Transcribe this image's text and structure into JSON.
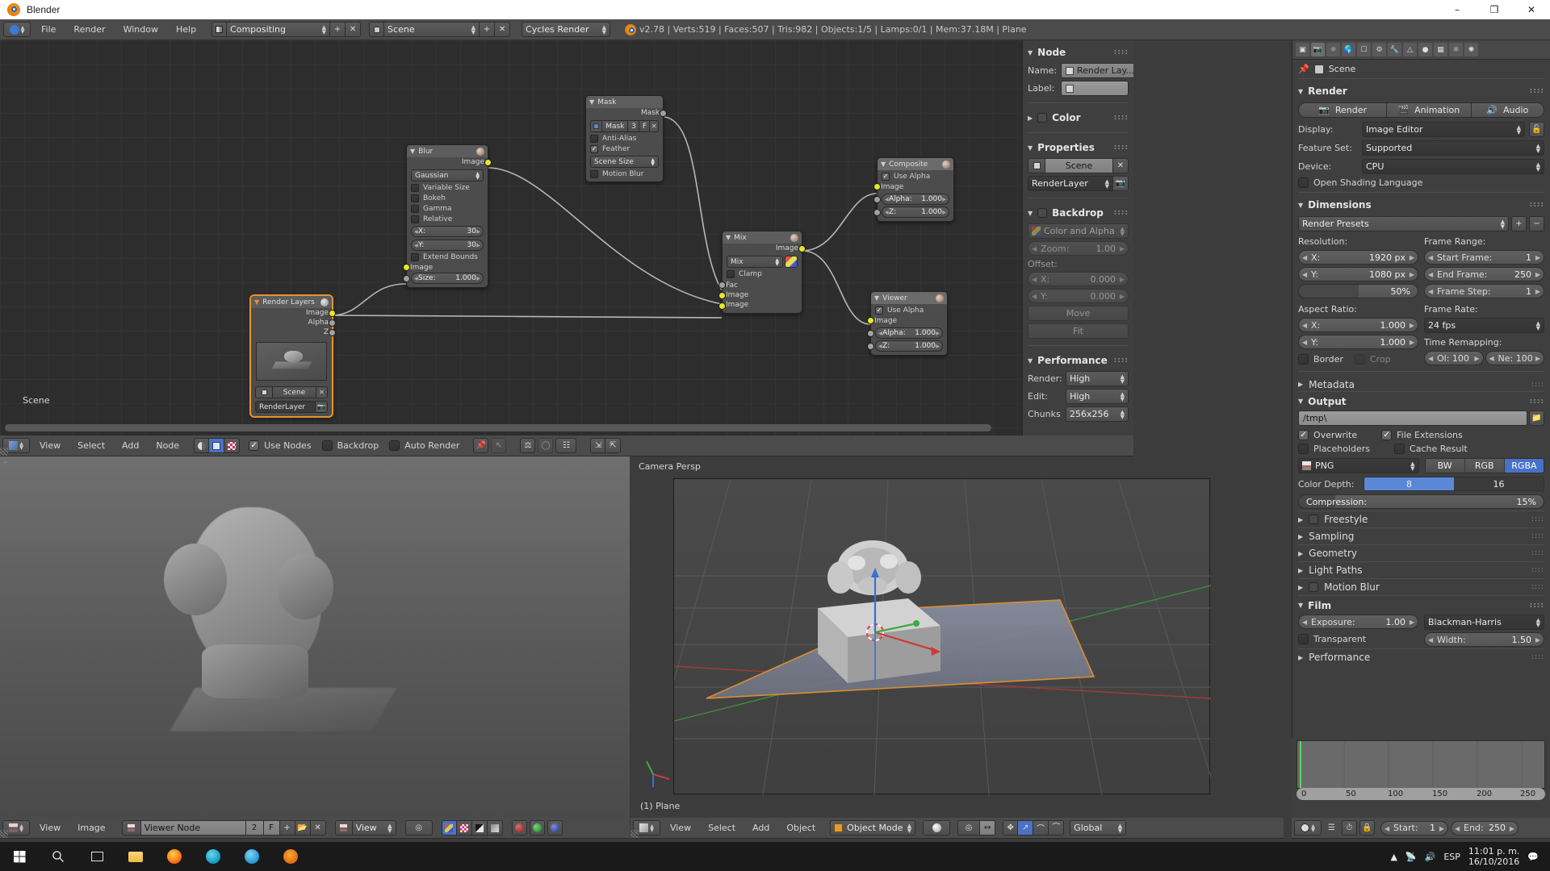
{
  "window": {
    "title": "Blender",
    "minimize": "–",
    "maximize": "❐",
    "close": "✕"
  },
  "info_header": {
    "menus": [
      "File",
      "Render",
      "Window",
      "Help"
    ],
    "screen_layout": "Compositing",
    "scene": "Scene",
    "engine": "Cycles Render",
    "status": "v2.78 | Verts:519 | Faces:507 | Tris:982 | Objects:1/5 | Lamps:0/1 | Mem:37.18M | Plane",
    "add_label": "+",
    "remove_label": "✕"
  },
  "node_editor": {
    "header": {
      "menus": [
        "View",
        "Select",
        "Add",
        "Node"
      ],
      "use_nodes": "Use Nodes",
      "backdrop": "Backdrop",
      "auto_render": "Auto Render"
    },
    "scene_overlay": "Scene",
    "nodes": [
      {
        "id": "render_layers",
        "title": "Render Layers",
        "selected": true,
        "outputs": [
          "Image",
          "Alpha",
          "Z"
        ],
        "scene": "Scene",
        "layer": "RenderLayer"
      },
      {
        "id": "blur",
        "title": "Blur",
        "outputs": [
          "Image"
        ],
        "filter_type": "Gaussian",
        "checks": [
          {
            "label": "Variable Size",
            "on": false
          },
          {
            "label": "Bokeh",
            "on": false
          },
          {
            "label": "Gamma",
            "on": false
          },
          {
            "label": "Relative",
            "on": false
          }
        ],
        "x_label": "X:",
        "x_value": "30",
        "y_label": "Y:",
        "y_value": "30",
        "extend_bounds": "Extend Bounds",
        "inputs": [
          "Image"
        ],
        "size_label": "Size:",
        "size_value": "1.000"
      },
      {
        "id": "mask",
        "title": "Mask",
        "outputs": [
          "Mask"
        ],
        "datablock": "Mask",
        "users": "3",
        "fake_user": "F",
        "anti_alias": "Anti-Alias",
        "feather": "Feather",
        "size_source": "Scene Size",
        "motion_blur": "Motion Blur"
      },
      {
        "id": "mix",
        "title": "Mix",
        "outputs": [
          "Image"
        ],
        "blend_mode": "Mix",
        "clamp": "Clamp",
        "inputs": [
          "Fac",
          "Image",
          "Image"
        ]
      },
      {
        "id": "composite",
        "title": "Composite",
        "use_alpha": "Use Alpha",
        "inputs": [
          "Image"
        ],
        "alpha_label": "Alpha:",
        "alpha_value": "1.000",
        "z_label": "Z:",
        "z_value": "1.000"
      },
      {
        "id": "viewer",
        "title": "Viewer",
        "use_alpha": "Use Alpha",
        "inputs": [
          "Image"
        ],
        "alpha_label": "Alpha:",
        "alpha_value": "1.000",
        "z_label": "Z:",
        "z_value": "1.000"
      }
    ],
    "sidebar": {
      "node_title": "Node",
      "name_label": "Name:",
      "name_value": "Render Lay...",
      "label_label": "Label:",
      "label_value": "",
      "color_title": "Color",
      "properties_title": "Properties",
      "scene_value": "Scene",
      "layer_value": "RenderLayer",
      "backdrop_title": "Backdrop",
      "backdrop_channel": "Color and Alpha",
      "zoom_label": "Zoom:",
      "zoom_value": "1.00",
      "offset_label": "Offset:",
      "offset_x_label": "X:",
      "offset_x_value": "0.000",
      "offset_y_label": "Y:",
      "offset_y_value": "0.000",
      "move_label": "Move",
      "fit_label": "Fit",
      "performance_title": "Performance",
      "render_label": "Render:",
      "render_value": "High",
      "edit_label": "Edit:",
      "edit_value": "High",
      "chunks_label": "Chunks",
      "chunks_value": "256x256"
    }
  },
  "properties": {
    "breadcrumb_scene": "Scene",
    "render": {
      "title": "Render",
      "render_btn": "Render",
      "animation_btn": "Animation",
      "audio_btn": "Audio",
      "display_label": "Display:",
      "display_value": "Image Editor",
      "feature_set_label": "Feature Set:",
      "feature_set_value": "Supported",
      "device_label": "Device:",
      "device_value": "CPU",
      "osl_label": "Open Shading Language"
    },
    "dimensions": {
      "title": "Dimensions",
      "presets": "Render Presets",
      "resolution_label": "Resolution:",
      "res_x_label": "X:",
      "res_x_value": "1920 px",
      "res_y_label": "Y:",
      "res_y_value": "1080 px",
      "res_percent": "50%",
      "aspect_label": "Aspect Ratio:",
      "aspect_x_label": "X:",
      "aspect_x_value": "1.000",
      "aspect_y_label": "Y:",
      "aspect_y_value": "1.000",
      "border_label": "Border",
      "crop_label": "Crop",
      "frame_range_label": "Frame Range:",
      "start_frame_label": "Start Frame:",
      "start_frame_value": "1",
      "end_frame_label": "End Frame:",
      "end_frame_value": "250",
      "frame_step_label": "Frame Step:",
      "frame_step_value": "1",
      "frame_rate_label": "Frame Rate:",
      "frame_rate_value": "24 fps",
      "time_remap_label": "Time Remapping:",
      "old_label": "Ol: 100",
      "new_label": "Ne: 100"
    },
    "metadata_title": "Metadata",
    "output": {
      "title": "Output",
      "path": "/tmp\\",
      "overwrite": "Overwrite",
      "file_extensions": "File Extensions",
      "placeholders": "Placeholders",
      "cache_result": "Cache Result",
      "format": "PNG",
      "bw": "BW",
      "rgb": "RGB",
      "rgba": "RGBA",
      "color_depth_label": "Color Depth:",
      "depth_8": "8",
      "depth_16": "16",
      "compression_label": "Compression:",
      "compression_value": "15%"
    },
    "collapsed": [
      "Freestyle",
      "Sampling",
      "Geometry",
      "Light Paths",
      "Motion Blur"
    ],
    "film": {
      "title": "Film",
      "exposure_label": "Exposure:",
      "exposure_value": "1.00",
      "transparent_label": "Transparent",
      "filter_type": "Blackman-Harris",
      "width_label": "Width:",
      "width_value": "1.50"
    },
    "performance_title": "Performance"
  },
  "image_editor": {
    "menus": [
      "View",
      "Image"
    ],
    "image_name": "Viewer Node",
    "users": "2",
    "fake_user": "F",
    "view_mode": "View"
  },
  "viewport": {
    "menus": [
      "View",
      "Select",
      "Add",
      "Object"
    ],
    "mode": "Object Mode",
    "orientation": "Global",
    "camera_label": "Camera Persp",
    "object_label": "(1) Plane"
  },
  "timeline": {
    "ticks": [
      "0",
      "50",
      "100",
      "150",
      "200",
      "250"
    ],
    "start_label": "Start:",
    "start_value": "1",
    "end_label": "End:",
    "end_value": "250",
    "current_frame": "1"
  },
  "taskbar": {
    "language": "ESP",
    "time": "11:01 p. m.",
    "date": "16/10/2016"
  },
  "colors": {
    "accent_blue": "#4872c8",
    "node_selected": "#e8932f",
    "socket_yellow": "#e6e62c",
    "socket_grey": "#a1a1a1"
  }
}
